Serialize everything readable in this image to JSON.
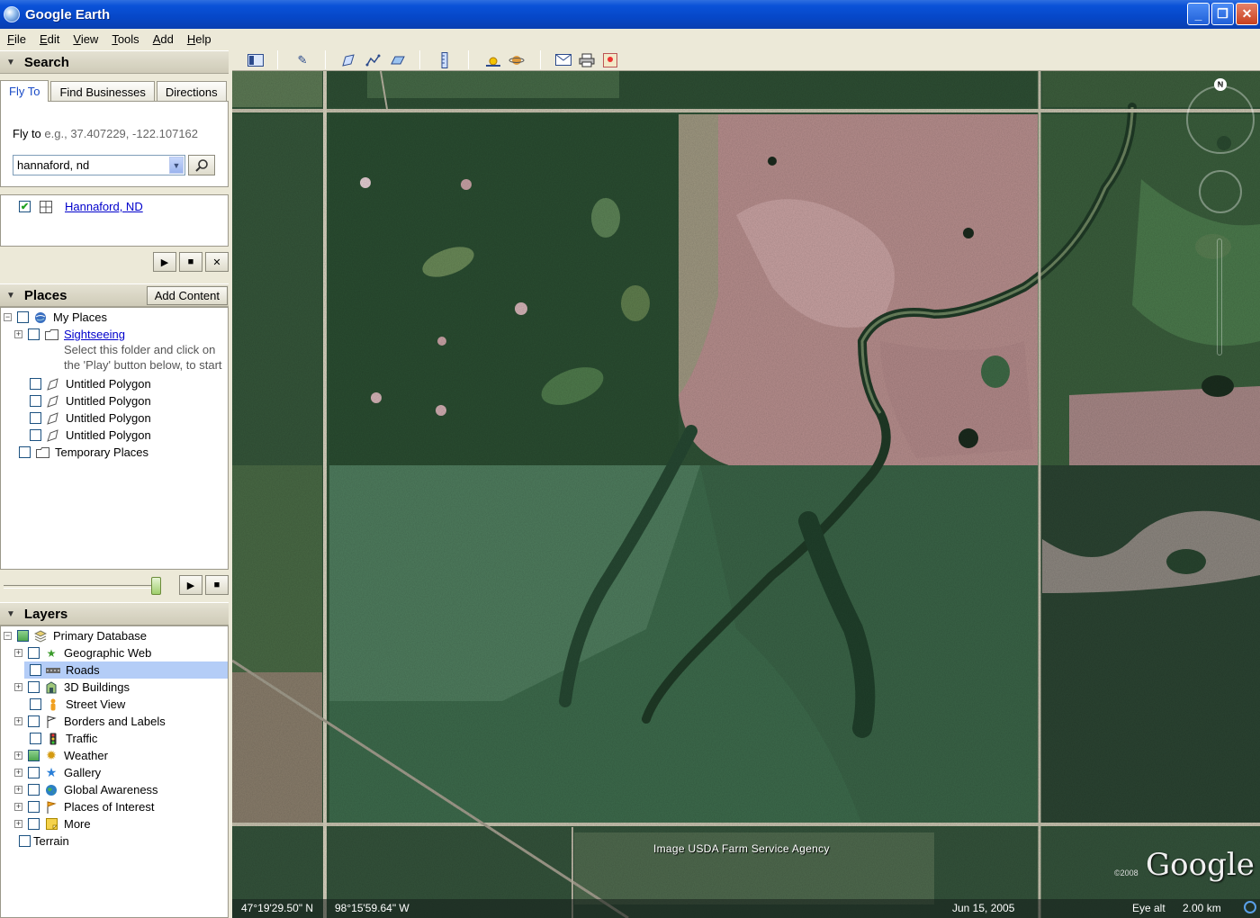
{
  "window": {
    "title": "Google Earth",
    "min": "_",
    "max": "❐",
    "close": "✕"
  },
  "menu": [
    "File",
    "Edit",
    "View",
    "Tools",
    "Add",
    "Help"
  ],
  "search": {
    "header": "Search",
    "tabs": [
      "Fly To",
      "Find Businesses",
      "Directions"
    ],
    "fly_label": "Fly to",
    "fly_example": "e.g., 37.407229, -122.107162",
    "query": "hannaford, nd",
    "result": "Hannaford, ND"
  },
  "places": {
    "header": "Places",
    "add_content": "Add Content",
    "my_places": "My Places",
    "sightseeing": "Sightseeing",
    "sightseeing_desc1": "Select this folder and click on",
    "sightseeing_desc2": "the 'Play' button below, to start",
    "polygons": [
      "Untitled Polygon",
      "Untitled Polygon",
      "Untitled Polygon",
      "Untitled Polygon"
    ],
    "temporary": "Temporary Places"
  },
  "layers": {
    "header": "Layers",
    "primary": "Primary Database",
    "items": [
      "Geographic Web",
      "Roads",
      "3D Buildings",
      "Street View",
      "Borders and Labels",
      "Traffic",
      "Weather",
      "Gallery",
      "Global Awareness",
      "Places of Interest",
      "More"
    ],
    "terrain": "Terrain"
  },
  "map": {
    "credit": "Image USDA Farm Service Agency",
    "logo": "Google",
    "copyright": "©2008",
    "compass": "N",
    "lat": "47°19'29.50\" N",
    "lon": "98°15'59.64\" W",
    "date": "Jun 15, 2005",
    "eye_alt_label": "Eye alt",
    "eye_alt": "2.00 km"
  },
  "icons": {
    "play": "▶",
    "stop": "■",
    "close": "✕",
    "search": "⚲",
    "collapse": "▼"
  }
}
